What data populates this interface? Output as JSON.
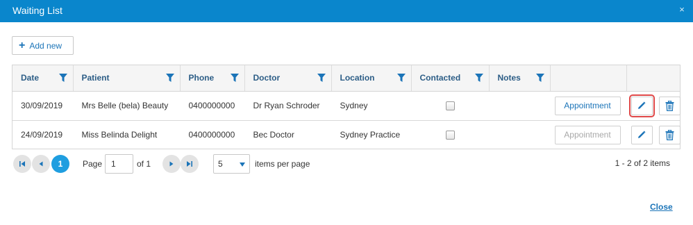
{
  "dialog": {
    "title": "Waiting List",
    "close_glyph": "×"
  },
  "toolbar": {
    "add_label": "Add new"
  },
  "table": {
    "columns": [
      "Date",
      "Patient",
      "Phone",
      "Doctor",
      "Location",
      "Contacted",
      "Notes"
    ],
    "rows": [
      {
        "date": "30/09/2019",
        "patient": "Mrs Belle (bela) Beauty",
        "phone": "0400000000",
        "doctor": "Dr Ryan Schroder",
        "location": "Sydney",
        "contacted": false,
        "notes": "",
        "appointment_label": "Appointment",
        "appointment_enabled": true
      },
      {
        "date": "24/09/2019",
        "patient": "Miss Belinda Delight",
        "phone": "0400000000",
        "doctor": "Bec Doctor",
        "location": "Sydney Practice",
        "contacted": false,
        "notes": "",
        "appointment_label": "Appointment",
        "appointment_enabled": false
      }
    ]
  },
  "pager": {
    "current_page": "1",
    "page_label": "Page",
    "page_value": "1",
    "of_label": "of 1",
    "page_size": "5",
    "items_per_page_label": "items per page",
    "info": "1 - 2 of 2 items"
  },
  "footer": {
    "close_label": "Close"
  },
  "colors": {
    "titlebar": "#0a86cc",
    "accent": "#1b74b8",
    "current_page": "#1f9ee0",
    "highlight": "#e04848"
  },
  "icons": {
    "add": "plus-icon",
    "filter": "filter-icon",
    "edit": "pencil-icon",
    "delete": "trash-icon",
    "close": "close-icon"
  }
}
